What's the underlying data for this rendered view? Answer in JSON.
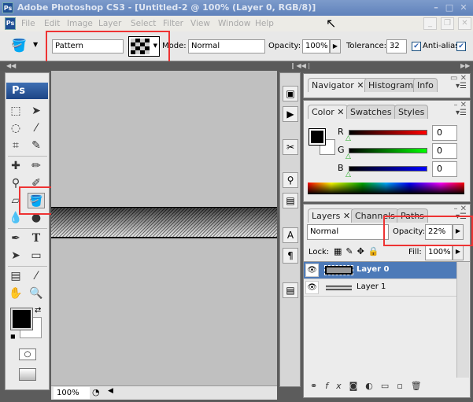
{
  "title": "Adobe Photoshop CS3 - [Untitled-2 @ 100% (Layer 0, RGB/8)]",
  "app_icon": "Ps",
  "menu": [
    "File",
    "Edit",
    "Image",
    "Layer",
    "Select",
    "Filter",
    "View",
    "Window",
    "Help"
  ],
  "options": {
    "fill_source": "Pattern",
    "mode_label": "Mode:",
    "mode": "Normal",
    "opacity_label": "Opacity:",
    "opacity": "100%",
    "tolerance_label": "Tolerance:",
    "tolerance": "32",
    "antialias_label": "Anti-alias",
    "antialias": true
  },
  "toolbox": {
    "logo": "Ps",
    "active_tool": "paint-bucket"
  },
  "status": {
    "zoom": "100%"
  },
  "navigator_panel": {
    "tabs": [
      "Navigator",
      "Histogram",
      "Info"
    ]
  },
  "color_panel": {
    "tabs": [
      "Color",
      "Swatches",
      "Styles"
    ],
    "channels": [
      {
        "label": "R",
        "value": "0"
      },
      {
        "label": "G",
        "value": "0"
      },
      {
        "label": "B",
        "value": "0"
      }
    ]
  },
  "layers_panel": {
    "tabs": [
      "Layers",
      "Channels",
      "Paths"
    ],
    "blend_mode": "Normal",
    "opacity_label": "Opacity:",
    "opacity": "22%",
    "lock_label": "Lock:",
    "fill_label": "Fill:",
    "fill": "100%",
    "layers": [
      {
        "name": "Layer 0",
        "selected": true
      },
      {
        "name": "Layer 1",
        "selected": false
      }
    ]
  },
  "colors": {
    "title": "#6a8cc4",
    "selection": "#4d7ab8",
    "highlight": "#e33333"
  }
}
